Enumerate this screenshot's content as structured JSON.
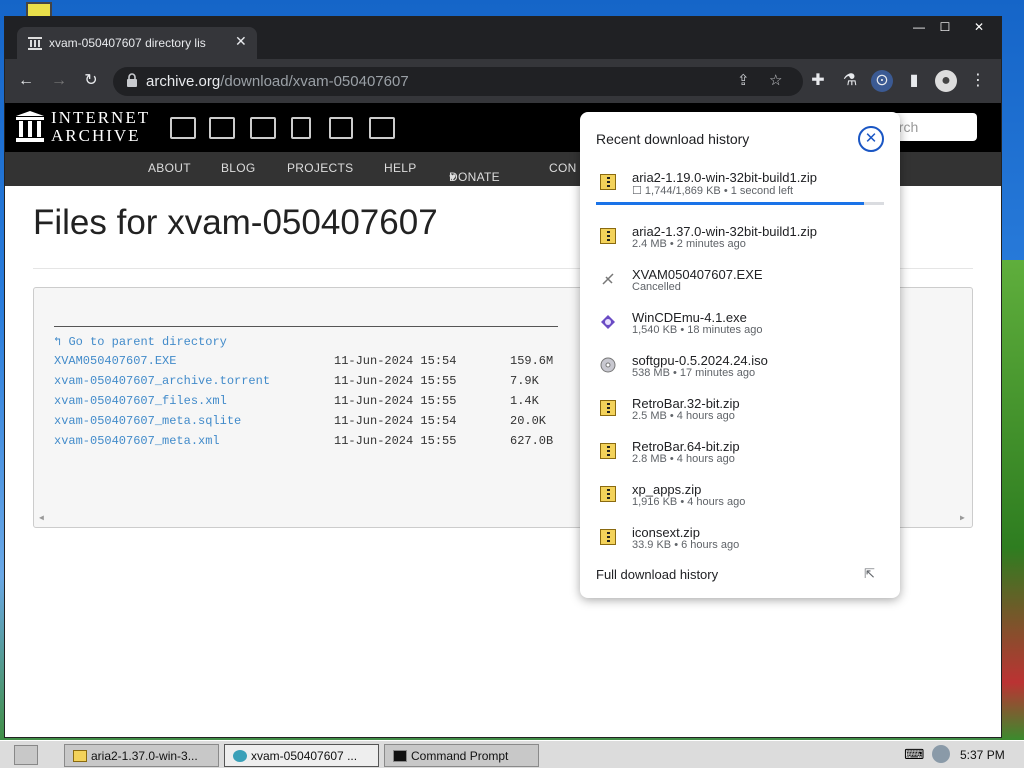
{
  "browser": {
    "tab_title": "xvam-050407607 directory lis",
    "tab_close": "✕",
    "window_min": "—",
    "window_max": "☐",
    "window_close": "✕",
    "url_host": "archive.org",
    "url_path": "/download/xvam-050407607"
  },
  "ia": {
    "logo_line1": "INTERNET",
    "logo_line2": "ARCHIVE",
    "search_placeholder": "arch",
    "nav": [
      "ABOUT",
      "BLOG",
      "PROJECTS",
      "HELP",
      "DONATE",
      "CON"
    ]
  },
  "page": {
    "title": "Files for xvam-050407607",
    "parent_link": "Go to parent directory",
    "files": [
      {
        "name": "XVAM050407607.EXE",
        "date": "11-Jun-2024 15:54",
        "size": "159.6M"
      },
      {
        "name": "xvam-050407607_archive.torrent",
        "date": "11-Jun-2024 15:55",
        "size": "7.9K"
      },
      {
        "name": "xvam-050407607_files.xml",
        "date": "11-Jun-2024 15:55",
        "size": "1.4K"
      },
      {
        "name": "xvam-050407607_meta.sqlite",
        "date": "11-Jun-2024 15:54",
        "size": "20.0K"
      },
      {
        "name": "xvam-050407607_meta.xml",
        "date": "11-Jun-2024 15:55",
        "size": "627.0B"
      }
    ]
  },
  "downloads": {
    "header": "Recent download history",
    "progress_fraction": 0.93,
    "items": [
      {
        "name": "aria2-1.19.0-win-32bit-build1.zip",
        "status": "☐ 1,744/1,869 KB • 1 second left",
        "icon": "zip-icon"
      },
      {
        "name": "aria2-1.37.0-win-32bit-build1.zip",
        "status": "2.4 MB • 2 minutes ago",
        "icon": "zip-icon"
      },
      {
        "name": "XVAM050407607.EXE",
        "status": "Cancelled",
        "icon": "cancelled-icon"
      },
      {
        "name": "WinCDEmu-4.1.exe",
        "status": "1,540 KB • 18 minutes ago",
        "icon": "exe-icon"
      },
      {
        "name": "softgpu-0.5.2024.24.iso",
        "status": "538 MB • 17 minutes ago",
        "icon": "disc-icon"
      },
      {
        "name": "RetroBar.32-bit.zip",
        "status": "2.5 MB • 4 hours ago",
        "icon": "zip-icon"
      },
      {
        "name": "RetroBar.64-bit.zip",
        "status": "2.8 MB • 4 hours ago",
        "icon": "zip-icon"
      },
      {
        "name": "xp_apps.zip",
        "status": "1,916 KB • 4 hours ago",
        "icon": "zip-icon"
      },
      {
        "name": "iconsext.zip",
        "status": "33.9 KB • 6 hours ago",
        "icon": "zip-icon"
      }
    ],
    "footer": "Full download history"
  },
  "taskbar": {
    "items": [
      "aria2-1.37.0-win-3...",
      "xvam-050407607 ...",
      "Command Prompt"
    ],
    "clock": "5:37 PM"
  }
}
